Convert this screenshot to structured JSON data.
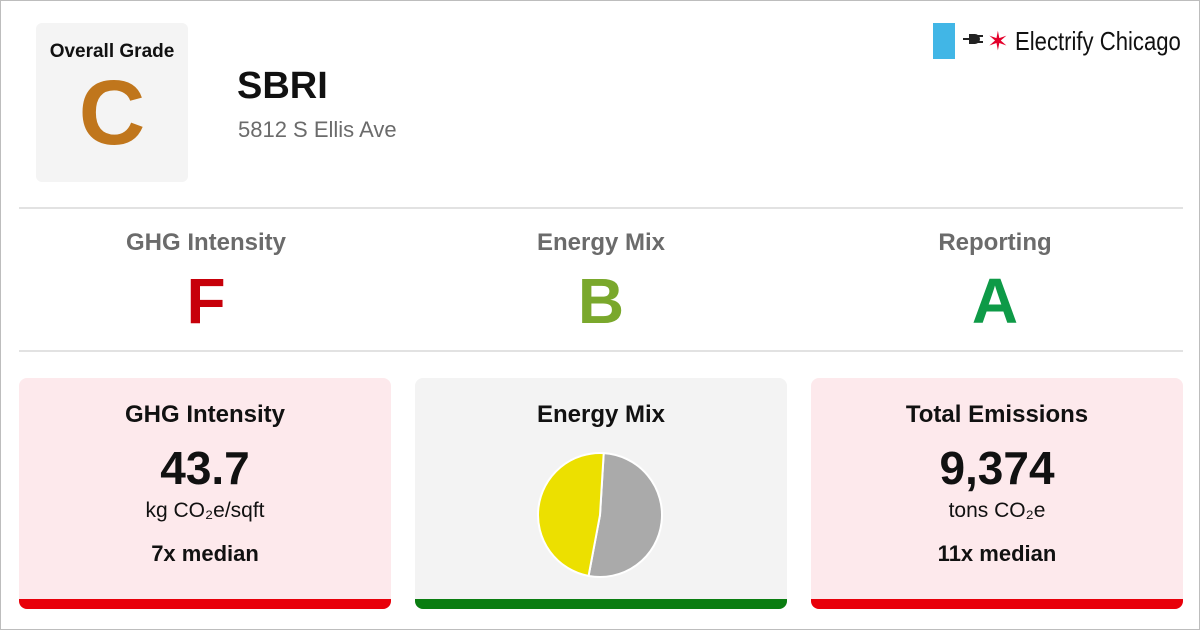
{
  "header": {
    "overall_label": "Overall Grade",
    "overall_grade": "C",
    "overall_color": "#c0761c",
    "building_name": "SBRI",
    "address": "5812 S Ellis Ave"
  },
  "brand": {
    "name": "Electrify Chicago",
    "icons": [
      "blue-flag-bar-icon",
      "plug-icon",
      "chicago-star-icon"
    ]
  },
  "grades": [
    {
      "label": "GHG Intensity",
      "grade": "F",
      "color": "#c7000a"
    },
    {
      "label": "Energy Mix",
      "grade": "B",
      "color": "#7aa82c"
    },
    {
      "label": "Reporting",
      "grade": "A",
      "color": "#0e9a47"
    }
  ],
  "cards": {
    "ghg": {
      "title": "GHG Intensity",
      "value": "43.7",
      "unit": "kg CO₂e/sqft",
      "median": "7x median",
      "bg": "#fde9ec",
      "bar_color": "#e8000a"
    },
    "mix": {
      "title": "Energy Mix",
      "bg": "#f3f3f3",
      "bar_color": "#0a7d11"
    },
    "total": {
      "title": "Total Emissions",
      "value": "9,374",
      "unit": "tons CO₂e",
      "median": "11x median",
      "bg": "#fde9ec",
      "bar_color": "#e8000a"
    }
  },
  "chart_data": {
    "type": "pie",
    "slices": [
      {
        "label": "",
        "value": 52,
        "color": "#aaaaaa"
      },
      {
        "label": "",
        "value": 48,
        "color": "#ece000"
      }
    ]
  }
}
